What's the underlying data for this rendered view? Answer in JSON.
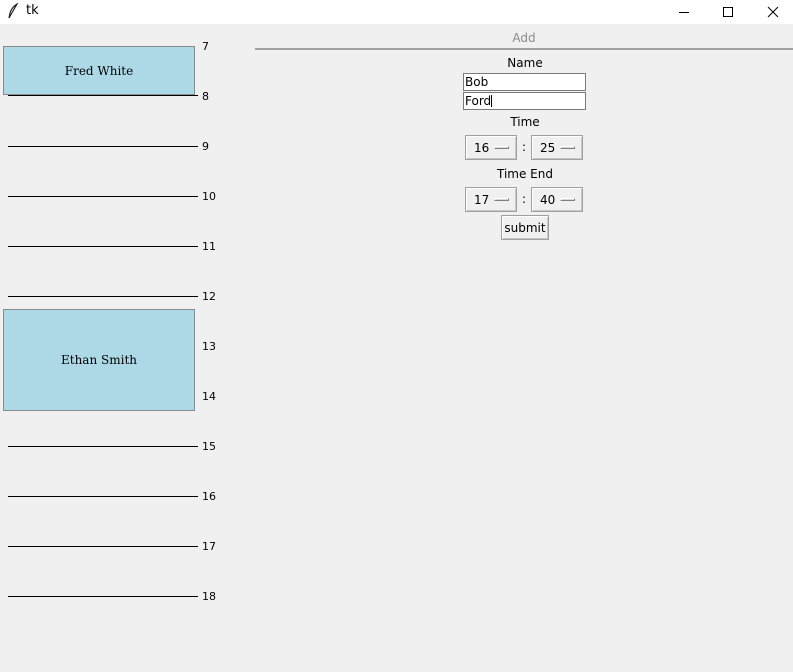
{
  "window": {
    "title": "tk"
  },
  "schedule": {
    "hour_labels": [
      "7",
      "8",
      "9",
      "10",
      "11",
      "12",
      "13",
      "14",
      "15",
      "16",
      "17",
      "18"
    ],
    "events": [
      {
        "name": "Fred White"
      },
      {
        "name": "Ethan Smith"
      }
    ]
  },
  "form": {
    "add_label": "Add",
    "name_label": "Name",
    "first_name": "Bob",
    "last_name": "Ford",
    "time_label": "Time",
    "time_hour": "16",
    "time_minute": "25",
    "time_separator": ":",
    "time_end_label": "Time End",
    "end_hour": "17",
    "end_minute": "40",
    "submit_label": "submit"
  },
  "colors": {
    "event_fill": "#add8e6",
    "background": "#f0f0f0"
  }
}
